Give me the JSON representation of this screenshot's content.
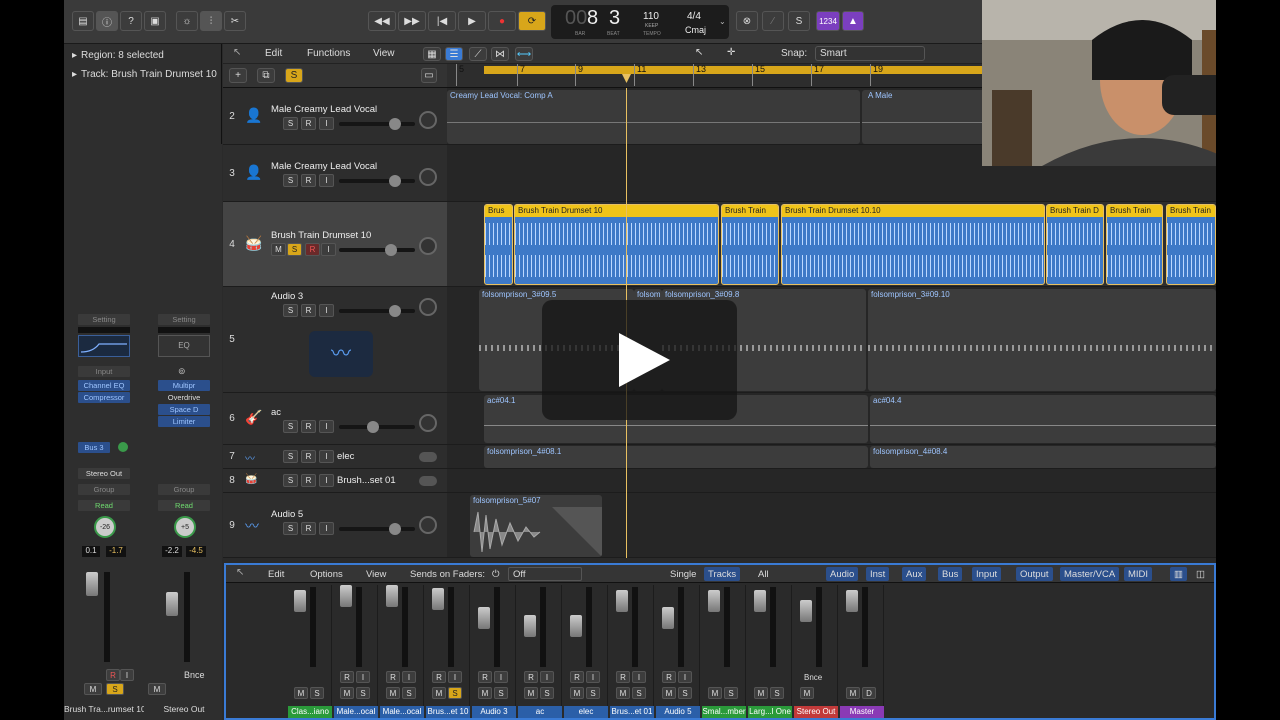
{
  "transport": {
    "bar": "8",
    "beat": "3",
    "bar_label": "BAR",
    "beat_label": "BEAT",
    "tempo": "110",
    "keep": "KEEP",
    "tempo_label": "TEMPO",
    "timesig": "4/4",
    "key": "Cmaj",
    "count_in": "1234"
  },
  "inspector": {
    "region": "Region: 8 selected",
    "track": "Track: Brush Train Drumset 10",
    "strip1": {
      "setting": "Setting",
      "input": "Input",
      "plugins": [
        "Channel EQ",
        "Compressor"
      ],
      "send": "Bus 3",
      "output": "Stereo Out",
      "group": "Group",
      "auto": "Read",
      "pan": "-26",
      "vol": "0.1",
      "peak": "-1.7",
      "m": "M",
      "s": "S",
      "r": "R",
      "i": "I",
      "name": "Brush Tra...rumset 10"
    },
    "strip2": {
      "setting": "Setting",
      "eq": "EQ",
      "plugins": [
        "Multipr",
        "Overdrive",
        "Space D",
        "Limiter"
      ],
      "group": "Group",
      "auto": "Read",
      "pan": "+5",
      "vol": "-2.2",
      "peak": "-4.5",
      "bnce": "Bnce",
      "m": "M",
      "name": "Stereo Out"
    }
  },
  "ws": {
    "edit": "Edit",
    "functions": "Functions",
    "view": "View",
    "snap_label": "Snap:",
    "snap": "Smart"
  },
  "ruler": [
    "5",
    "7",
    "9",
    "11",
    "13",
    "15",
    "17",
    "19"
  ],
  "tracks": [
    {
      "num": "2",
      "name": "Male Creamy Lead Vocal"
    },
    {
      "num": "3",
      "name": "Male Creamy Lead Vocal"
    },
    {
      "num": "4",
      "name": "Brush Train Drumset 10",
      "m": "M",
      "s": "S",
      "r": "R",
      "i": "I"
    },
    {
      "num": "5",
      "name": "Audio 3"
    },
    {
      "num": "6",
      "name": "ac"
    },
    {
      "num": "7",
      "name": "elec"
    },
    {
      "num": "8",
      "name": "Brush...set 01"
    },
    {
      "num": "9",
      "name": "Audio 5"
    }
  ],
  "regions": {
    "vocal": "Creamy Lead Vocal: Comp A",
    "vocal2": "A Male",
    "drum": [
      "Brus",
      "Brush Train Drumset 10",
      "Brush Train",
      "Brush Train Drumset 10.10",
      "Brush Train D",
      "Brush Train",
      "Brush Train"
    ],
    "audio3": [
      "folsomprison_3#09.5",
      "folsom",
      "folsomprison_3#09.8",
      "folsomprison_3#09.10"
    ],
    "ac": [
      "ac#04.1",
      "ac#04.4"
    ],
    "elec": [
      "folsomprison_4#08.1",
      "folsomprison_4#08.4"
    ],
    "a5": "folsomprison_5#07"
  },
  "mixer": {
    "edit": "Edit",
    "options": "Options",
    "view": "View",
    "sends": "Sends on Faders:",
    "off": "Off",
    "single": "Single",
    "tracks": "Tracks",
    "all": "All",
    "filters": [
      "Audio",
      "Inst",
      "Aux",
      "Bus",
      "Input",
      "Output",
      "Master/VCA",
      "MIDI"
    ],
    "strips": [
      {
        "name": "Clas...iano",
        "color": "#2a9a3a"
      },
      {
        "name": "Male...ocal",
        "color": "#2b5fa8"
      },
      {
        "name": "Male...ocal",
        "color": "#2b5fa8"
      },
      {
        "name": "Brus...et 10",
        "color": "#2b5fa8"
      },
      {
        "name": "Audio 3",
        "color": "#2b5fa8"
      },
      {
        "name": "ac",
        "color": "#2b5fa8"
      },
      {
        "name": "elec",
        "color": "#2b5fa8"
      },
      {
        "name": "Brus...et 01",
        "color": "#2b5fa8"
      },
      {
        "name": "Audio 5",
        "color": "#2b5fa8"
      },
      {
        "name": "Smal...mber",
        "color": "#2a9a3a"
      },
      {
        "name": "Larg...l One",
        "color": "#2a9a3a"
      },
      {
        "name": "Stereo Out",
        "color": "#c23a3a"
      },
      {
        "name": "Master",
        "color": "#8a3ab5"
      }
    ],
    "bnce": "Bnce"
  }
}
